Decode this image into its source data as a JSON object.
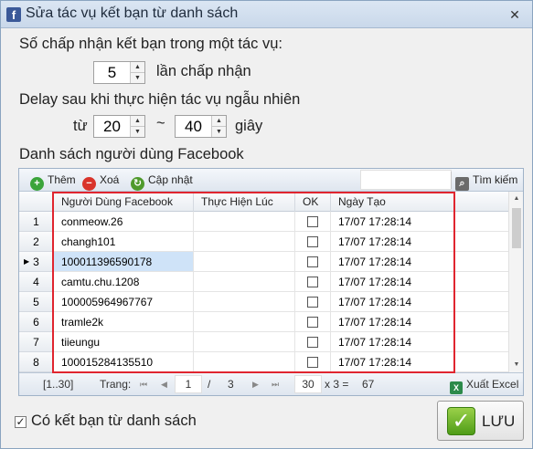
{
  "window": {
    "title": "Sửa tác vụ kết bạn từ danh sách",
    "logo_letter": "f",
    "close_glyph": "✕"
  },
  "form": {
    "accept_label": "Số chấp nhận kết bạn trong một tác vụ:",
    "accept_value": "5",
    "accept_unit": "lần chấp nhận",
    "delay_label": "Delay sau khi thực hiện tác vụ ngẫu nhiên",
    "from_label": "từ",
    "delay_from": "20",
    "tilde": "~",
    "delay_to": "40",
    "seconds_label": "giây",
    "list_label": "Danh sách người dùng Facebook"
  },
  "toolbar": {
    "add_label": "Thêm",
    "delete_label": "Xoá",
    "update_label": "Cập nhật",
    "search_label": "Tìm kiếm"
  },
  "grid": {
    "columns": [
      "Người Dùng Facebook",
      "Thực Hiện Lúc",
      "OK",
      "Ngày Tạo"
    ],
    "rows": [
      {
        "num": "1",
        "user": "conmeow.26",
        "time": "",
        "date": "17/07 17:28:14"
      },
      {
        "num": "2",
        "user": "changh101",
        "time": "",
        "date": "17/07 17:28:14"
      },
      {
        "num": "3",
        "user": "100011396590178",
        "time": "",
        "date": "17/07 17:28:14"
      },
      {
        "num": "4",
        "user": "camtu.chu.1208",
        "time": "",
        "date": "17/07 17:28:14"
      },
      {
        "num": "5",
        "user": "100005964967767",
        "time": "",
        "date": "17/07 17:28:14"
      },
      {
        "num": "6",
        "user": "tramle2k",
        "time": "",
        "date": "17/07 17:28:14"
      },
      {
        "num": "7",
        "user": "tiieungu",
        "time": "",
        "date": "17/07 17:28:14"
      },
      {
        "num": "8",
        "user": "100015284135510",
        "time": "",
        "date": "17/07 17:28:14"
      }
    ],
    "selected_row": 3
  },
  "pager": {
    "range": "[1..30]",
    "page_label": "Trang:",
    "current_page": "1",
    "slash": "/",
    "total_pages": "3",
    "page_size": "30",
    "multiply": "x 3 =",
    "total": "67",
    "export_label": "Xuất Excel"
  },
  "footer": {
    "checkbox_label": "Có kết bạn từ danh sách",
    "checkbox_checked": true,
    "save_label": "LƯU"
  },
  "colors": {
    "highlight_frame": "#e0252f",
    "selected_row": "#cfe3f8",
    "facebook_blue": "#3b5998"
  }
}
